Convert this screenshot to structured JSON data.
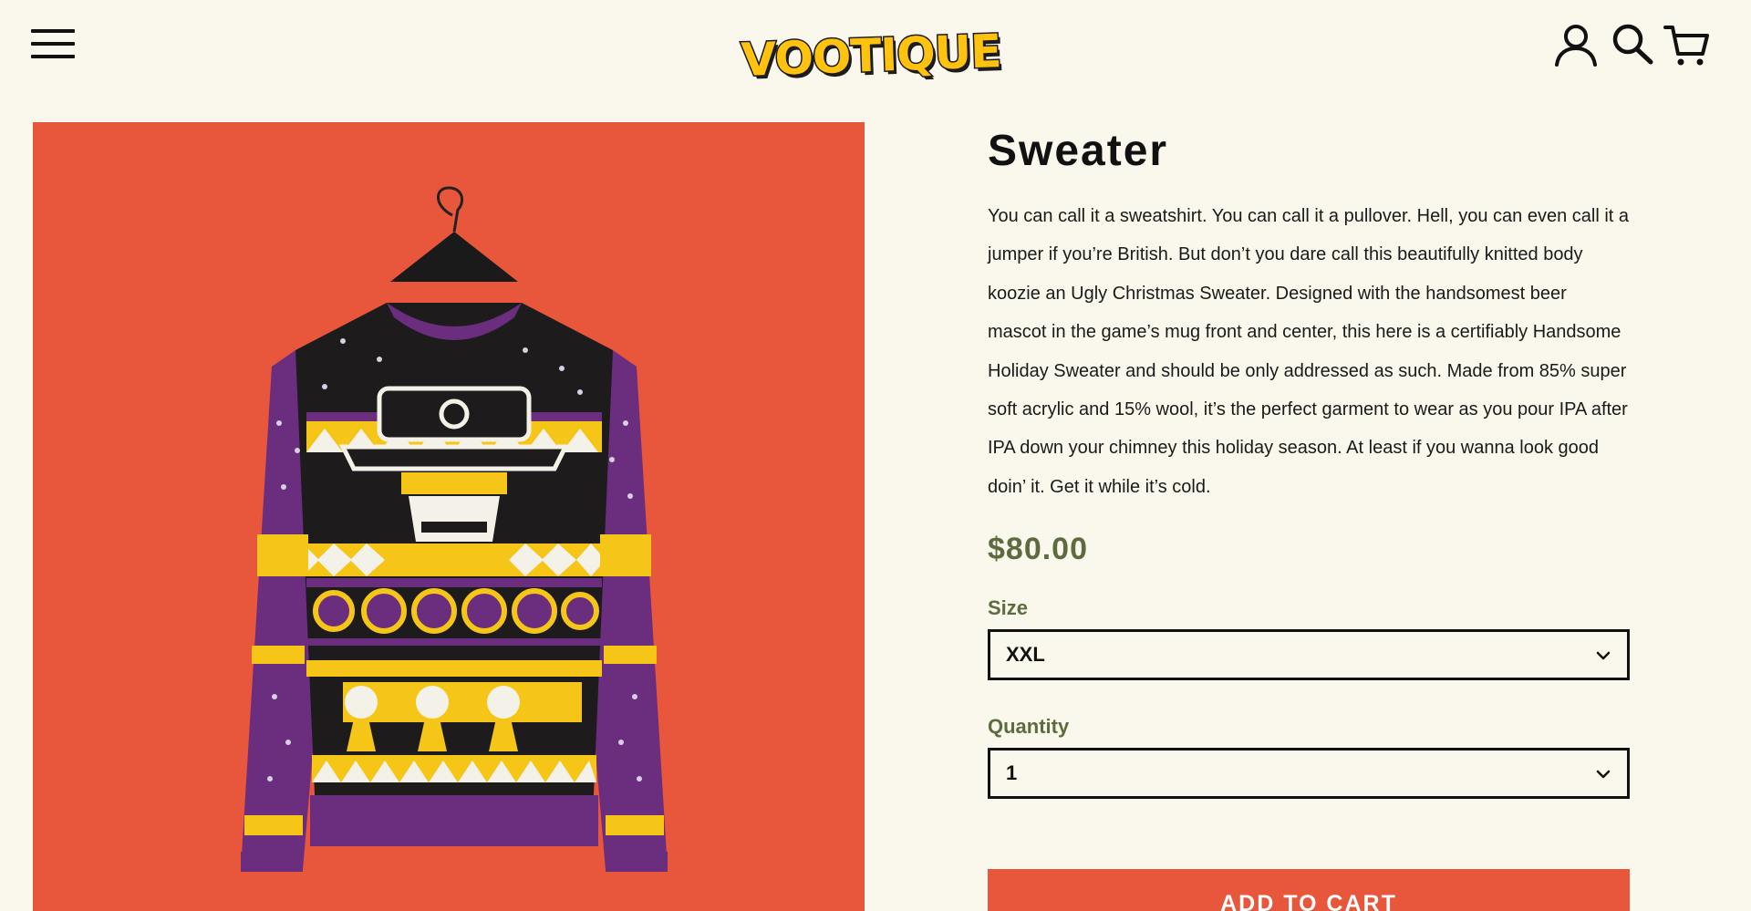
{
  "header": {
    "logo_text": "VOOTIQUE",
    "icons": [
      "menu-icon",
      "account-icon",
      "search-icon",
      "cart-icon"
    ]
  },
  "product": {
    "title": "Sweater",
    "description": "You can call it a sweatshirt. You can call it a pullover. Hell, you can even call it a jumper if you’re British. But don’t you dare call this beautifully knitted body koozie an Ugly Christmas Sweater. Designed with the handsomest beer mascot in the game’s mug front and center, this here is a certifiably Handsome Holiday Sweater and should be only addressed as such. Made from 85% super soft acrylic and 15% wool, it’s the perfect garment to wear as you pour IPA after IPA down your chimney this holiday season. At least if you wanna look good doin’ it. Get it while it’s cold.",
    "price": "$80.00",
    "size_label": "Size",
    "size_value": "XXL",
    "quantity_label": "Quantity",
    "quantity_value": "1",
    "add_to_cart_label": "ADD TO CART"
  },
  "colors": {
    "background": "#faf8ec",
    "accent": "#e8563c",
    "price_olive": "#5d6b3f",
    "sweater_purple": "#6b2d7e",
    "sweater_yellow": "#f5c518"
  }
}
